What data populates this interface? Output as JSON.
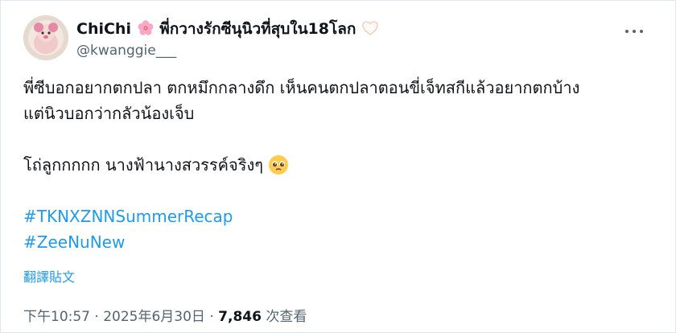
{
  "tweet": {
    "display_name": "ChiChi",
    "display_name_suffix": "พี่กวางรักซีนุนิวที่สุบใน18โลก",
    "handle": "@kwanggie___",
    "body_line1": "พี่ซีบอกอยากตกปลา ตกหมึกกลางดึก เห็นคนตกปลาตอนขี่เจ็ทสกีแล้วอยากตกบ้าง",
    "body_line2": "แต่นิวบอกว่ากลัวน้องเจ็บ",
    "body_line3": "โถ่ลูกกกกก นางฟ้านางสวรรค์จริงๆ",
    "hashtags": [
      "#TKNXZNNSummerRecap",
      "#ZeeNuNew"
    ],
    "translate_label": "翻譯貼文",
    "time": "下午10:57",
    "date": "2025年6月30日",
    "separator": "·",
    "views_count": "7,846",
    "views_label": "次查看"
  },
  "colors": {
    "link": "#1d9bf0",
    "text": "#0f1419",
    "muted": "#536471",
    "border": "#e1e8ed"
  },
  "icons": {
    "name_emoji_1": "cherry-blossom-icon",
    "name_emoji_2": "white-heart-icon",
    "body_emoji": "pleading-face-icon",
    "more": "more-horizontal-icon"
  }
}
